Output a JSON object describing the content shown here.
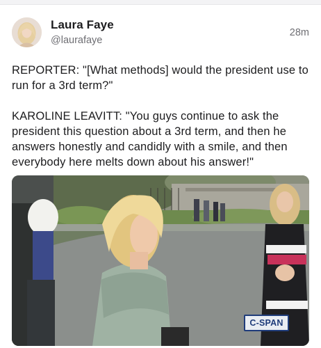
{
  "post": {
    "author": {
      "display_name": "Laura Faye",
      "handle": "@laurafaye"
    },
    "time_ago": "28m",
    "paragraphs": [
      "REPORTER: \"[What methods] would the president use to run for a 3rd term?\"",
      "KAROLINE LEAVITT: \"You guys continue to ask the president this question about a 3rd term, and then he answers honestly and candidly with a smile, and then everybody here melts down about his answer!\""
    ],
    "media": {
      "watermark": "C-SPAN"
    }
  },
  "colors": {
    "name": "#1c1c1e",
    "secondary": "#6e6e73",
    "cspan_blue": "#1f3c7a"
  }
}
